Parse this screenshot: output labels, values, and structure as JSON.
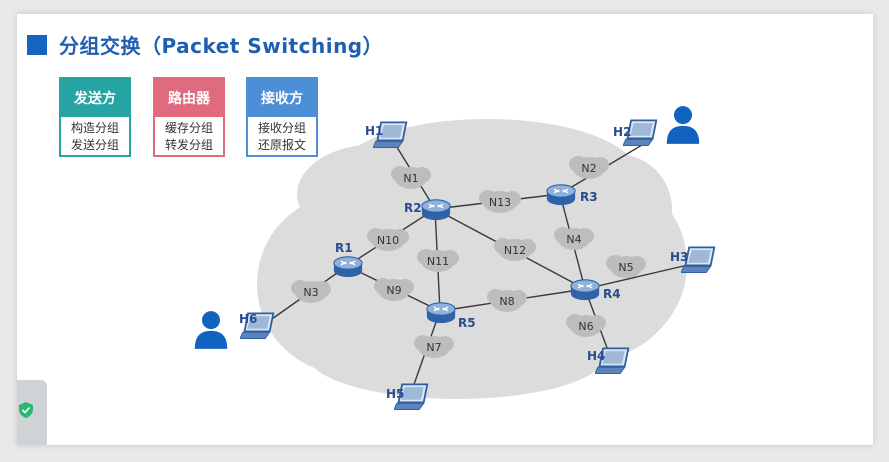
{
  "title": "分组交换（Packet Switching）",
  "cards": [
    {
      "head": "发送方",
      "lines": [
        "构造分组",
        "发送分组"
      ],
      "color": "#26a3a3"
    },
    {
      "head": "路由器",
      "lines": [
        "缓存分组",
        "转发分组"
      ],
      "color": "#e06a7e"
    },
    {
      "head": "接收方",
      "lines": [
        "接收分组",
        "还原报文"
      ],
      "color": "#4d8fd6"
    }
  ],
  "routers": {
    "R1": "R1",
    "R2": "R2",
    "R3": "R3",
    "R4": "R4",
    "R5": "R5"
  },
  "hosts": {
    "H1": "H1",
    "H2": "H2",
    "H3": "H3",
    "H4": "H4",
    "H5": "H5",
    "H6": "H6"
  },
  "networks": {
    "N1": "N1",
    "N2": "N2",
    "N3": "N3",
    "N4": "N4",
    "N5": "N5",
    "N6": "N6",
    "N7": "N7",
    "N8": "N8",
    "N9": "N9",
    "N10": "N10",
    "N11": "N11",
    "N12": "N12",
    "N13": "N13"
  },
  "colors": {
    "accent": "#1565c0",
    "label": "#2a4d8f",
    "cloud": "#d9d9d9",
    "node_cloud": "#bdbdbd"
  }
}
